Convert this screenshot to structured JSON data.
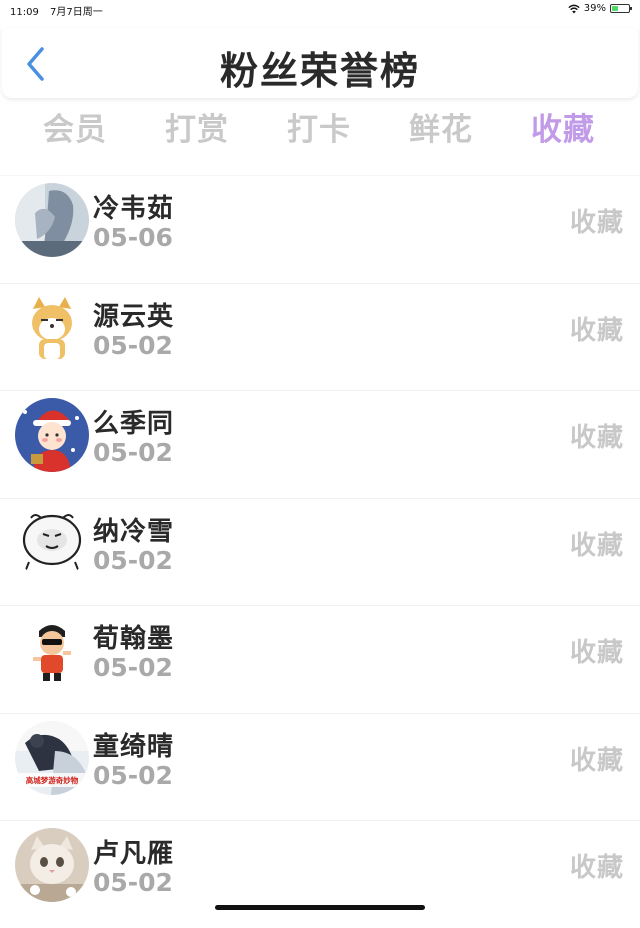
{
  "status": {
    "time": "11:09",
    "date": "7月7日周一",
    "battery_text": "39%",
    "battery_level": 0.39
  },
  "header": {
    "title": "粉丝荣誉榜",
    "accent": "#4a90e2"
  },
  "tabs": [
    {
      "label": "会员",
      "active": false
    },
    {
      "label": "打赏",
      "active": false
    },
    {
      "label": "打卡",
      "active": false
    },
    {
      "label": "鲜花",
      "active": false
    },
    {
      "label": "收藏",
      "active": true
    }
  ],
  "active_tab_color": "#c29be8",
  "fans": [
    {
      "name": "冷韦茹",
      "date": "05-06",
      "action": "收藏",
      "avatar": "blurry-photo-avatar"
    },
    {
      "name": "源云英",
      "date": "05-02",
      "action": "收藏",
      "avatar": "shiba-dog-avatar"
    },
    {
      "name": "么季同",
      "date": "05-02",
      "action": "收藏",
      "avatar": "christmas-cartoon-avatar"
    },
    {
      "name": "纳冷雪",
      "date": "05-02",
      "action": "收藏",
      "avatar": "meme-face-avatar"
    },
    {
      "name": "荀翰墨",
      "date": "05-02",
      "action": "收藏",
      "avatar": "cartoon-kid-sunglasses-avatar"
    },
    {
      "name": "童绮晴",
      "date": "05-02",
      "action": "收藏",
      "avatar": "photo-text-avatar",
      "avatar_text": "高城梦游奇妙物"
    },
    {
      "name": "卢凡雁",
      "date": "05-02",
      "action": "收藏",
      "avatar": "cat-photo-avatar"
    }
  ]
}
